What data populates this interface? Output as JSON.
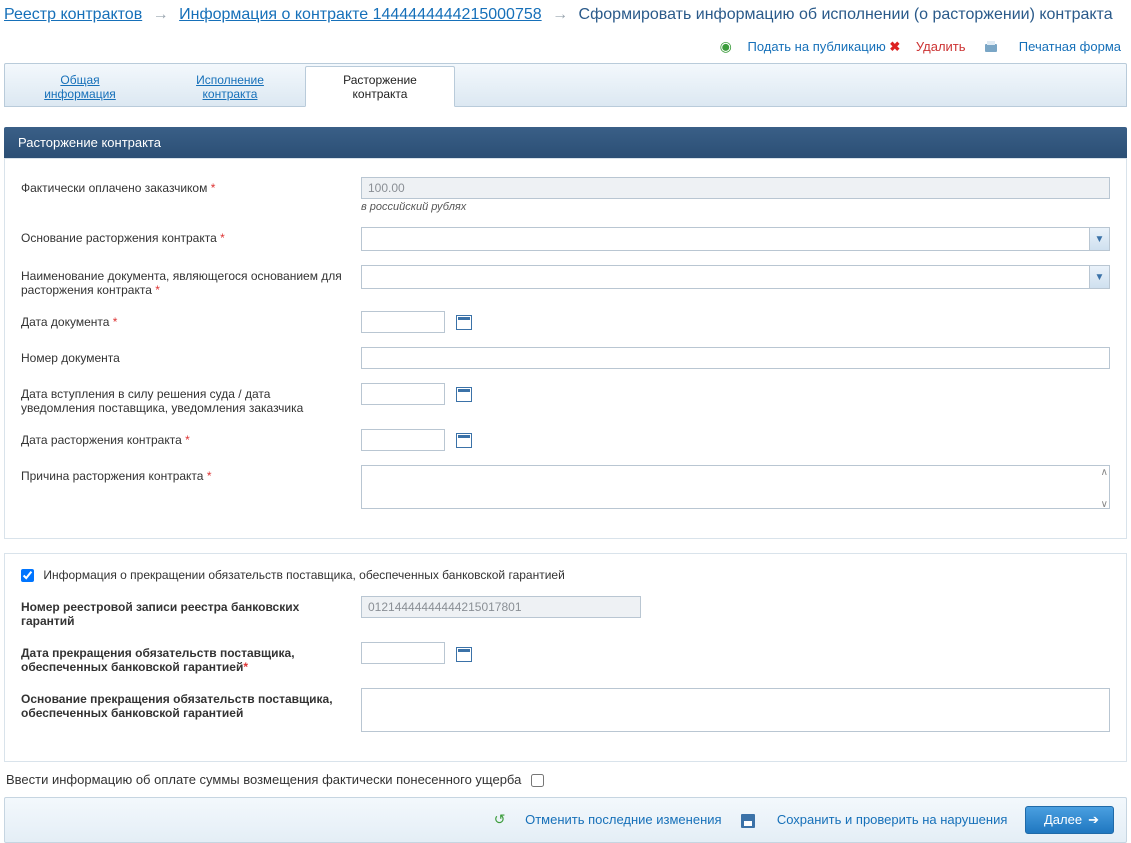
{
  "breadcrumb": {
    "registry": "Реестр контрактов",
    "info": "Информация о контракте 1444444444215000758",
    "current": "Сформировать информацию об исполнении (о расторжении) контракта"
  },
  "actions": {
    "publish": "Подать на публикацию",
    "delete": "Удалить",
    "print": "Печатная форма"
  },
  "tabs": {
    "general": "Общая информация",
    "execution": "Исполнение контракта",
    "termination": "Расторжение контракта"
  },
  "panel": {
    "title": "Расторжение контракта"
  },
  "form": {
    "paid_label": "Фактически оплачено заказчиком",
    "paid_value": "100.00",
    "paid_hint": "в российский рублях",
    "basis_label": "Основание расторжения контракта",
    "doc_name_label": "Наименование документа, являющегося основанием для расторжения контракта",
    "doc_date_label": "Дата документа",
    "doc_number_label": "Номер документа",
    "court_date_label": "Дата вступления в силу решения суда / дата уведомления поставщика, уведомления заказчика",
    "term_date_label": "Дата расторжения контракта",
    "reason_label": "Причина расторжения контракта"
  },
  "guarantee": {
    "checkbox_label": "Информация о прекращении обязательств поставщика, обеспеченных банковской гарантией",
    "reg_num_label": "Номер реестровой записи реестра банковских гарантий",
    "reg_num_value": "01214444444444215017801",
    "term_date_label": "Дата прекращения обязательств поставщика, обеспеченных банковской гарантией",
    "basis_label": "Основание прекращения обязательств поставщика, обеспеченных банковской гарантией"
  },
  "bottom": {
    "damages_label": "Ввести информацию об оплате суммы возмещения фактически понесенного ущерба"
  },
  "footer": {
    "undo": "Отменить последние изменения",
    "save_check": "Сохранить и проверить на нарушения",
    "next": "Далее"
  }
}
